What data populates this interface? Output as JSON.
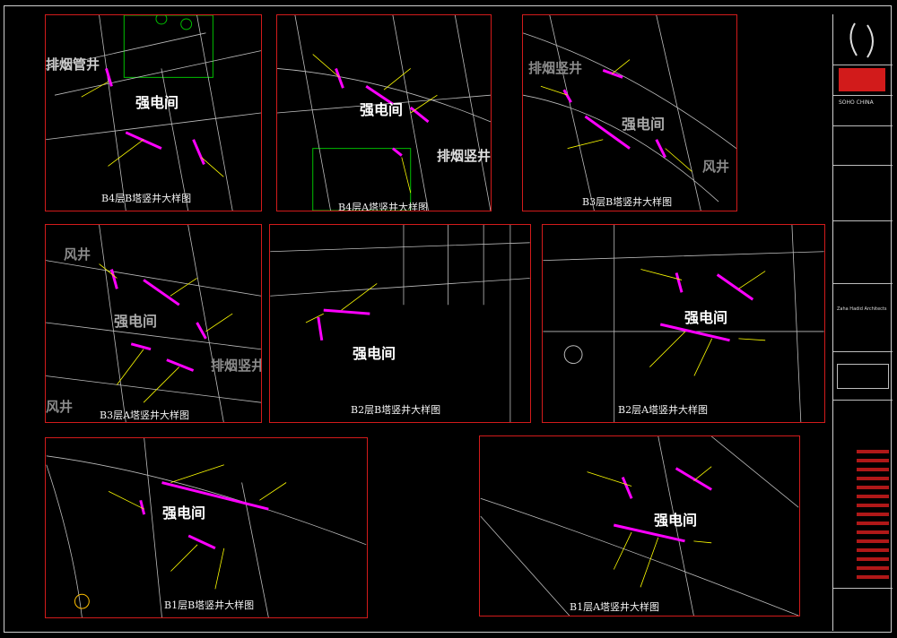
{
  "drawing": {
    "panels": [
      {
        "title": "B4层B塔竖井大样图",
        "room": "强电间",
        "side": "排烟管井"
      },
      {
        "title": "B4层A塔竖井大样图",
        "room": "强电间",
        "side": "排烟竖井"
      },
      {
        "title": "B3层B塔竖井大样图",
        "room": "强电间",
        "side": "排烟竖井",
        "side2": "风井"
      },
      {
        "title": "B3层A塔竖井大样图",
        "room": "强电间",
        "side": "风井",
        "side2": "排烟竖井",
        "side3": "风井"
      },
      {
        "title": "B2层B塔竖井大样图",
        "room": "强电间"
      },
      {
        "title": "B2层A塔竖井大样图",
        "room": "强电间"
      },
      {
        "title": "B1层B塔竖井大样图",
        "room": "强电间"
      },
      {
        "title": "B1层A塔竖井大样图",
        "room": "强电间"
      }
    ]
  },
  "titleblock": {
    "logo_icon": "soho-china-logo",
    "company": "SOHO CHINA",
    "architect": "Zaha Hadid Architects"
  },
  "colors": {
    "frame": "#d21b1b",
    "annotation": "#ffff00",
    "equipment": "#ff00ff",
    "leader": "#ffff00",
    "wall": "#c8c8c8",
    "green": "#00c000"
  }
}
